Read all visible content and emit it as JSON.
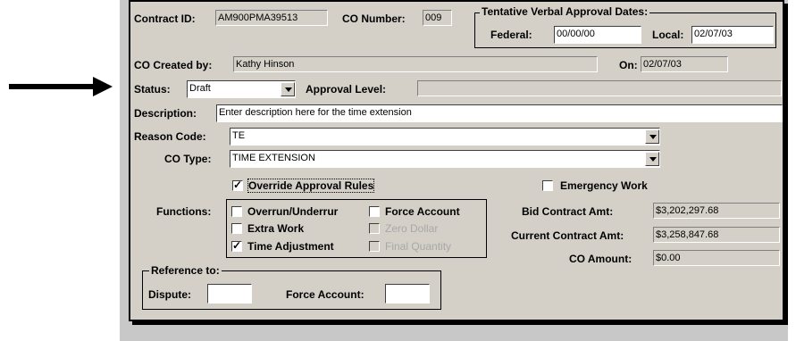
{
  "contract": {
    "id_label": "Contract ID:",
    "id_value": "AM900PMA39513",
    "co_number_label": "CO Number:",
    "co_number_value": "009"
  },
  "tentative": {
    "title": "Tentative Verbal Approval Dates:",
    "federal_label": "Federal:",
    "federal_value": "00/00/00",
    "local_label": "Local:",
    "local_value": "02/07/03"
  },
  "created": {
    "label": "CO Created by:",
    "value": "Kathy Hinson",
    "on_label": "On:",
    "on_value": "02/07/03"
  },
  "status": {
    "label": "Status:",
    "value": "Draft",
    "approval_label": "Approval Level:",
    "approval_value": ""
  },
  "description": {
    "label": "Description:",
    "value": "Enter description here for the time extension"
  },
  "reason": {
    "label": "Reason Code:",
    "value": "TE"
  },
  "co_type": {
    "label": "CO Type:",
    "value": "TIME EXTENSION"
  },
  "override": {
    "label": "Override Approval Rules",
    "checked": true
  },
  "emergency": {
    "label": "Emergency Work",
    "checked": false
  },
  "functions": {
    "label": "Functions:",
    "overrun": "Overrun/Underrur",
    "force_account": "Force Account",
    "extra_work": "Extra Work",
    "zero_dollar": "Zero Dollar",
    "time_adjustment": "Time Adjustment",
    "final_quantity": "Final Quantity"
  },
  "amounts": {
    "bid_label": "Bid Contract Amt:",
    "bid_value": "$3,202,297.68",
    "current_label": "Current Contract Amt:",
    "current_value": "$3,258,847.68",
    "co_label": "CO Amount:",
    "co_value": "$0.00"
  },
  "reference": {
    "title": "Reference to:",
    "dispute_label": "Dispute:",
    "dispute_value": "",
    "force_label": "Force Account:",
    "force_value": ""
  },
  "icons": {
    "arrow": "pointer-arrow-icon",
    "dropdown": "chevron-down-icon",
    "check": "check-icon"
  }
}
